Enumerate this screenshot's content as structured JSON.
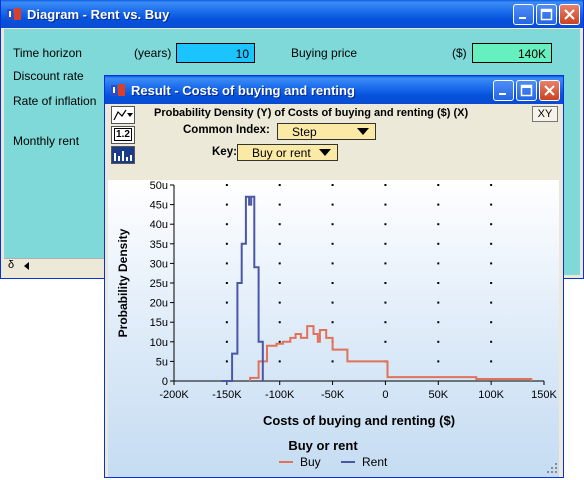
{
  "diagram_window": {
    "title": "Diagram - Rent vs. Buy",
    "fields": {
      "time_horizon": {
        "label": "Time horizon",
        "unit": "(years)",
        "value": "10"
      },
      "buying_price": {
        "label": "Buying price",
        "unit": "($)",
        "value": "140K"
      },
      "discount_rate": {
        "label": "Discount rate"
      },
      "rate_of_inflation": {
        "label": "Rate of inflation"
      },
      "monthly_rent": {
        "label": "Monthly rent"
      }
    },
    "scroll_glyph": "δ"
  },
  "result_window": {
    "title": "Result - Costs of buying and renting",
    "header": "Probability Density (Y) of Costs of buying and renting ($) (X)",
    "xy_button": "XY",
    "toolbar_badge": "1.2",
    "common_index": {
      "label": "Common Index:",
      "value": "Step"
    },
    "key": {
      "label": "Key:",
      "value": "Buy or rent"
    }
  },
  "colors": {
    "buy": "#e2715a",
    "rent": "#4b56a6",
    "diagram_bg": "#7fd9d9",
    "input_blue": "#1cc4ff",
    "input_green": "#66f0c0",
    "dropdown_bg": "#fbe9a6"
  },
  "chart_data": {
    "type": "line",
    "step": true,
    "xlabel": "Costs of buying and renting ($)",
    "ylabel": "Probability Density",
    "legend_title": "Buy or rent",
    "legend_position": "bottom",
    "grid": "dots",
    "xlim": [
      -200000,
      150000
    ],
    "ylim": [
      0,
      50
    ],
    "x_ticks": [
      -200000,
      -150000,
      -100000,
      -50000,
      0,
      50000,
      100000,
      150000
    ],
    "x_tick_labels": [
      "-200K",
      "-150K",
      "-100K",
      "-50K",
      "0",
      "50K",
      "100K",
      "150K"
    ],
    "y_ticks": [
      0,
      5,
      10,
      15,
      20,
      25,
      30,
      35,
      40,
      45,
      50
    ],
    "y_tick_labels": [
      "0",
      "5u",
      "10u",
      "15u",
      "20u",
      "25u",
      "30u",
      "35u",
      "40u",
      "45u",
      "50u"
    ],
    "series": [
      {
        "name": "Buy",
        "color": "#e2715a",
        "points": [
          [
            -128000,
            0
          ],
          [
            -128000,
            0.8
          ],
          [
            -120000,
            0.8
          ],
          [
            -120000,
            5
          ],
          [
            -112000,
            5
          ],
          [
            -112000,
            9
          ],
          [
            -103000,
            9
          ],
          [
            -103000,
            9.5
          ],
          [
            -97000,
            9.5
          ],
          [
            -97000,
            10
          ],
          [
            -90000,
            10
          ],
          [
            -90000,
            11
          ],
          [
            -85000,
            11
          ],
          [
            -85000,
            12
          ],
          [
            -80000,
            12
          ],
          [
            -80000,
            11
          ],
          [
            -74000,
            11
          ],
          [
            -74000,
            14
          ],
          [
            -68000,
            14
          ],
          [
            -68000,
            12
          ],
          [
            -64000,
            12
          ],
          [
            -64000,
            10
          ],
          [
            -62000,
            10
          ],
          [
            -62000,
            13
          ],
          [
            -56000,
            13
          ],
          [
            -56000,
            11
          ],
          [
            -50000,
            11
          ],
          [
            -50000,
            8
          ],
          [
            -36000,
            8
          ],
          [
            -36000,
            5
          ],
          [
            2000,
            5
          ],
          [
            2000,
            1
          ],
          [
            86000,
            1
          ],
          [
            86000,
            0.5
          ],
          [
            138000,
            0.5
          ],
          [
            138000,
            0
          ]
        ]
      },
      {
        "name": "Rent",
        "color": "#4b56a6",
        "points": [
          [
            -155000,
            0
          ],
          [
            -145000,
            0
          ],
          [
            -145000,
            7
          ],
          [
            -140000,
            7
          ],
          [
            -140000,
            25
          ],
          [
            -136000,
            25
          ],
          [
            -136000,
            35
          ],
          [
            -132000,
            35
          ],
          [
            -132000,
            47
          ],
          [
            -129000,
            47
          ],
          [
            -129000,
            45
          ],
          [
            -127000,
            45
          ],
          [
            -127000,
            47
          ],
          [
            -124000,
            47
          ],
          [
            -124000,
            29
          ],
          [
            -120000,
            29
          ],
          [
            -120000,
            10
          ],
          [
            -116000,
            10
          ],
          [
            -116000,
            0
          ]
        ]
      }
    ]
  }
}
